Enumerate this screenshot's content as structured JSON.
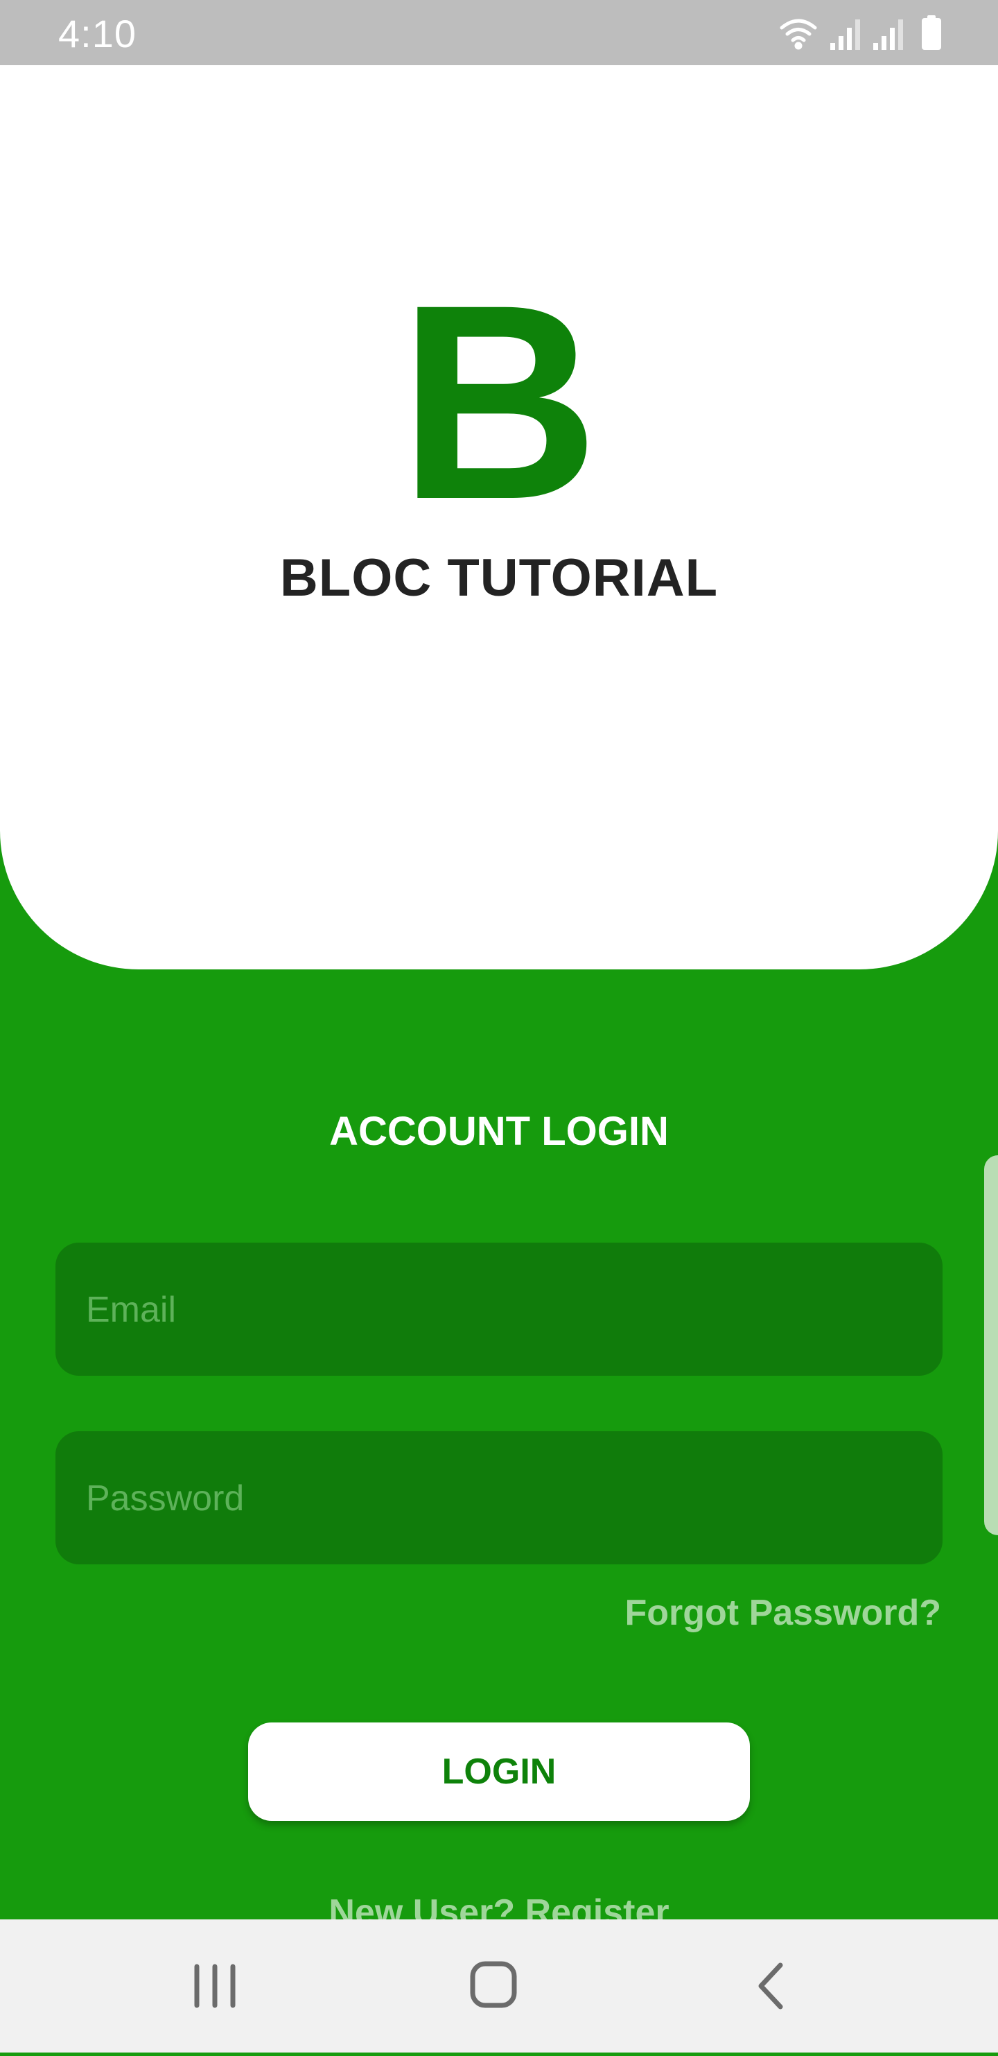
{
  "status_bar": {
    "time": "4:10",
    "icons": [
      "wifi-icon",
      "signal-icon",
      "signal-icon",
      "battery-icon"
    ]
  },
  "header": {
    "logo_letter": "B",
    "title": "BLOC TUTORIAL"
  },
  "login": {
    "heading": "ACCOUNT LOGIN",
    "email_placeholder": "Email",
    "password_placeholder": "Password",
    "forgot_label": "Forgot Password?",
    "login_label": "LOGIN",
    "register_label": "New User? Register"
  },
  "nav_bar": {
    "icons": [
      "recent-apps-icon",
      "home-icon",
      "back-icon"
    ]
  },
  "colors": {
    "background": "#169b0d",
    "logo": "#0e820a",
    "field": "#107c0b",
    "link": "#9fd69a",
    "status_bar": "#bdbdbd",
    "nav_bar": "#f1f1f1"
  }
}
